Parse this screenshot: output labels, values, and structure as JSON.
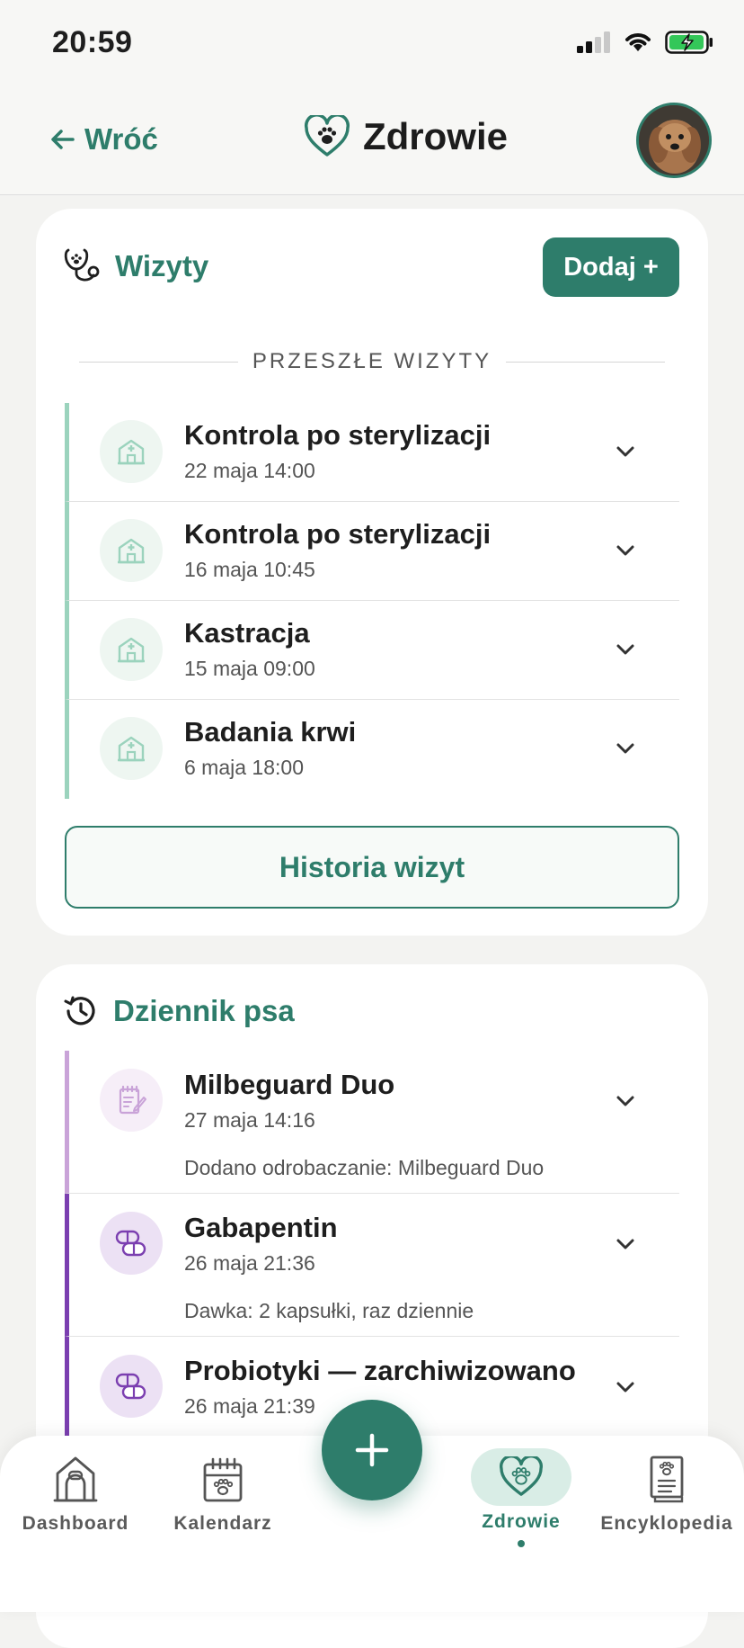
{
  "status_bar": {
    "time": "20:59"
  },
  "header": {
    "back_label": "Wróć",
    "title": "Zdrowie"
  },
  "visits": {
    "title": "Wizyty",
    "add_label": "Dodaj +",
    "section_label": "PRZESZŁE WIZYTY",
    "items": [
      {
        "name": "Kontrola po sterylizacji",
        "date": "22 maja 14:00"
      },
      {
        "name": "Kontrola po sterylizacji",
        "date": "16 maja 10:45"
      },
      {
        "name": "Kastracja",
        "date": "15 maja 09:00"
      },
      {
        "name": "Badania krwi",
        "date": "6 maja 18:00"
      }
    ],
    "history_label": "Historia wizyt"
  },
  "journal": {
    "title": "Dziennik psa",
    "items": [
      {
        "name": "Milbeguard Duo",
        "date": "27 maja 14:16",
        "desc": "Dodano odrobaczanie: Milbeguard Duo",
        "icon": "notepad-icon",
        "accent": "#c9a3d8"
      },
      {
        "name": "Gabapentin",
        "date": "26 maja 21:36",
        "desc": "Dawka: 2 kapsułki, raz dziennie",
        "icon": "pill-icon",
        "accent": "#7b3fb0"
      },
      {
        "name": "Probiotyki — zarchiwizowano",
        "date": "26 maja 21:39",
        "desc": "",
        "icon": "pill-icon",
        "accent": "#7b3fb0"
      }
    ]
  },
  "nav": {
    "items": [
      {
        "label": "Dashboard",
        "icon": "house-icon"
      },
      {
        "label": "Kalendarz",
        "icon": "calendar-icon"
      },
      {
        "label": "Zdrowie",
        "icon": "heart-paw-icon",
        "active": true
      },
      {
        "label": "Encyklopedia",
        "icon": "book-icon"
      }
    ]
  },
  "colors": {
    "accent": "#2e7d6b",
    "visit_bar": "#9bd3bd",
    "background": "#f3f3f1"
  }
}
